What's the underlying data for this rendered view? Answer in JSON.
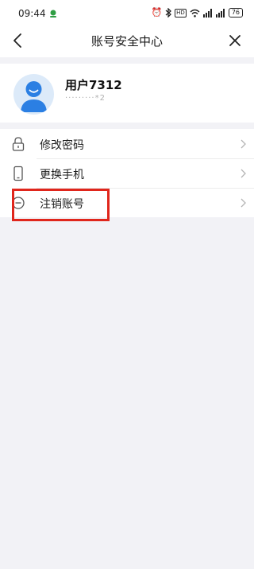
{
  "status_bar": {
    "time": "09:44",
    "hd_badge": "HD",
    "battery": "76"
  },
  "nav": {
    "title": "账号安全中心"
  },
  "profile": {
    "username": "用户7312",
    "phone_masked": "·········*2"
  },
  "menu": {
    "items": [
      {
        "label": "修改密码",
        "icon": "lock-icon"
      },
      {
        "label": "更换手机",
        "icon": "phone-icon"
      },
      {
        "label": "注销账号",
        "icon": "minus-circle-icon"
      }
    ]
  },
  "annotation": {
    "highlight_color": "#e0261c"
  }
}
